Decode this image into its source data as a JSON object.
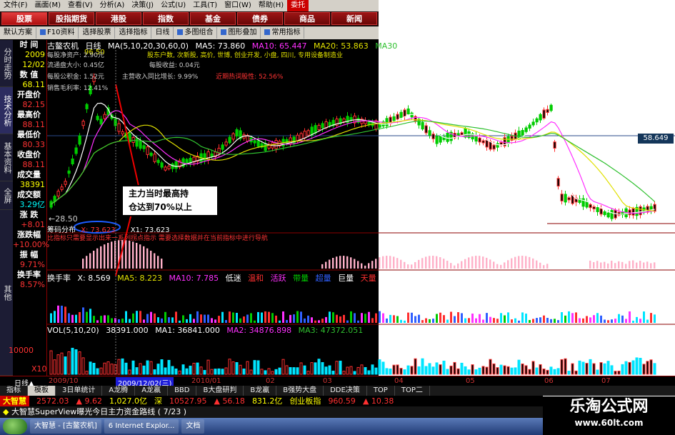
{
  "menu": [
    "文件(F)",
    "画面(M)",
    "查看(V)",
    "分析(A)",
    "决策(J)",
    "公式(U)",
    "工具(T)",
    "窗口(W)",
    "帮助(H)",
    "委托"
  ],
  "category_tabs": [
    "股票",
    "股指期货",
    "港股",
    "指数",
    "基金",
    "债券",
    "商品",
    "新闻"
  ],
  "toolbar": [
    "默认方案",
    "F10资料",
    "选择股票",
    "选择指标",
    "日线",
    "多图组合",
    "图形叠加",
    "常用指标"
  ],
  "vertical_tabs": [
    "分时走势",
    "技术分析",
    "基本资料",
    "全屏",
    "其他"
  ],
  "info": {
    "time_label": "时 间",
    "year": "2009",
    "date": "12/02",
    "value_label": "数 值",
    "value": "68.11",
    "open_label": "开盘价",
    "open": "82.15",
    "high_label": "最高价",
    "high": "88.11",
    "low_label": "最低价",
    "low": "80.33",
    "close_label": "收盘价",
    "close": "88.11",
    "vol_label": "成交量",
    "vol": "38391",
    "amount_label": "成交额",
    "amount": "3.29亿",
    "chg_label": "涨 跌",
    "chg": "+8.01",
    "chgpct_label": "涨跌幅",
    "chgpct": "+10.00%",
    "amp_label": "振 幅",
    "amp": "9.71%",
    "turn_label": "换手率",
    "turn": "8.57%"
  },
  "main": {
    "stock": "古鳌农机",
    "period": "日线",
    "ma_params": "MA(5,10,20,30,60,0)",
    "ma5": "MA5: 73.860",
    "ma10": "MA10: 65.447",
    "ma20": "MA20: 53.863",
    "ma30": "MA30",
    "peak_price": "96.50",
    "fund_lines": [
      "每股净资产: 2.90元",
      "流通盘大小: 0.45亿",
      "每股收益: 0.04元",
      "每股公积金: 1.52元",
      "主营收入同比增长: 9.99%",
      "近期热词股性: 52.56%",
      "销售毛利率: 12.41%"
    ],
    "overlay_note": "股东户数, 次新股, 高价, 世博, 创业开发, 小盘, 四川, 专用设备制造业",
    "price_marker": "58.649",
    "low_marker": "←28.50",
    "chip_label": "筹码分布",
    "chip_x": "X: 73.623",
    "chip_x1": "X1: 73.623",
    "chip_note": "比指标只需要显示出来一系列拐点指示  需要选择数据并在当前指标中进行导航",
    "annotation": [
      "主力当时最高持",
      "仓达到70%以上"
    ],
    "turnover_header": [
      "换手率",
      "X: 8.569",
      "MA5: 8.223",
      "MA10: 7.785",
      "低迷",
      "温和",
      "活跃",
      "带量",
      "超量",
      "巨量",
      "天量"
    ],
    "vol_header": [
      "VOL(5,10,20)",
      "38391.000",
      "MA1: 36841.000",
      "MA2: 34876.898",
      "MA3: 47372.051"
    ],
    "vol_tick": "10000",
    "vol_unit": "X10"
  },
  "date_axis": {
    "period": "日线▲",
    "labels": [
      "2009/10",
      "2009/12/02(三)",
      "2010/01",
      "02",
      "03",
      "04",
      "05",
      "06",
      "07"
    ]
  },
  "bottom_tabs": [
    "指标",
    "模板",
    "3日单统计",
    "A龙腾",
    "A龙嬴",
    "BBD",
    "B大盘研判",
    "B龙嬴",
    "B强势大盘",
    "DDE决策",
    "TOP",
    "TOP二"
  ],
  "ticker": {
    "brand": "大智慧",
    "sh_index": "2572.03",
    "sh_chg": "9.62",
    "sh_amount": "1,027.0亿",
    "sz_label": "深",
    "sz_index": "10527.95",
    "sz_chg": "56.18",
    "sz_amount": "831.2亿",
    "cy_label": "创业板指",
    "cy_index": "960.59",
    "cy_chg": "10.38"
  },
  "message": "大智慧SuperView曝光今日主力资金路线 ( 7/23 )",
  "taskbar": [
    "大智慧 - [古鳌农机]",
    "6 Internet Explor...",
    "文档"
  ],
  "watermark": {
    "title": "乐淘公式网",
    "url": "www.60lt.com"
  },
  "colors": {
    "up": "#ff3030",
    "down": "#00cc00",
    "ma5": "#ffffff",
    "ma10": "#ff30ff",
    "ma20": "#e0e000",
    "ma30": "#30c030"
  }
}
